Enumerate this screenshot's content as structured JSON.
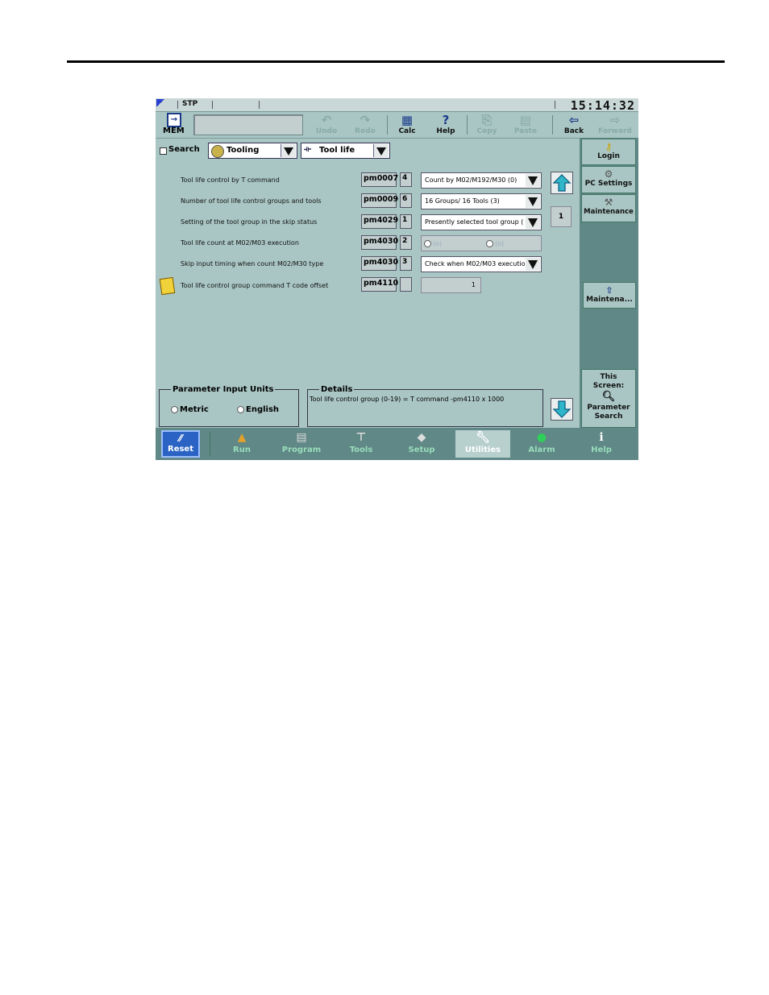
{
  "status": {
    "mode": "STP",
    "clock": "15:14:32"
  },
  "toolbar": {
    "mem_label": "MEM",
    "buttons": [
      {
        "label": "Undo",
        "enabled": false
      },
      {
        "label": "Redo",
        "enabled": false
      },
      {
        "label": "Calc",
        "enabled": true
      },
      {
        "label": "Help",
        "enabled": true
      },
      {
        "label": "Copy",
        "enabled": false
      },
      {
        "label": "Paste",
        "enabled": false
      },
      {
        "label": "Back",
        "enabled": true
      },
      {
        "label": "Forward",
        "enabled": false
      }
    ]
  },
  "filters": {
    "search_label": "Search",
    "category": "Tooling",
    "subcategory": "Tool life"
  },
  "parameters": [
    {
      "label": "Tool life control by T command",
      "id": "pm0007",
      "value": "4",
      "setting": "Count by M02/M192/M30 (0)"
    },
    {
      "label": "Number of tool life control groups and tools",
      "id": "pm0009",
      "value": "6",
      "setting": "16 Groups/ 16 Tools (3)"
    },
    {
      "label": "Setting of the tool group in the skip status",
      "id": "pm4029",
      "value": "1",
      "setting": "Presently selected tool group ("
    },
    {
      "label": "Tool life count at M02/M03 execution",
      "id": "pm4030",
      "value": "2",
      "setting": ""
    },
    {
      "label": "Skip input timing when count M02/M30 type",
      "id": "pm4030",
      "value": "3",
      "setting": "Check when M02/M03 executio"
    },
    {
      "label": "Tool life control group command T code offset",
      "id": "pm4110",
      "value": "",
      "setting": "1"
    }
  ],
  "radio_options": {
    "opt1": "(o)",
    "opt2": "(o)"
  },
  "page_indicator": "1",
  "units": {
    "legend": "Parameter Input Units",
    "metric": "Metric",
    "english": "English",
    "selected": "Metric"
  },
  "details": {
    "legend": "Details",
    "text": "Tool life control group (0-19) = T command -pm4110 x 1000"
  },
  "sidebar": {
    "login": "Login",
    "pc_settings": "PC Settings",
    "maintenance": "Maintenance",
    "maintena_btn": "Maintena...",
    "this_screen_1": "This",
    "this_screen_2": "Screen:",
    "param_search_1": "Parameter",
    "param_search_2": "Search"
  },
  "nav": {
    "reset": "Reset",
    "items": [
      "Run",
      "Program",
      "Tools",
      "Setup",
      "Utilities",
      "Alarm",
      "Help"
    ],
    "active": "Utilities"
  },
  "colors": {
    "background": "#a9c6c4",
    "panel_dark": "#5f8886",
    "reset_blue": "#2a63c4"
  }
}
